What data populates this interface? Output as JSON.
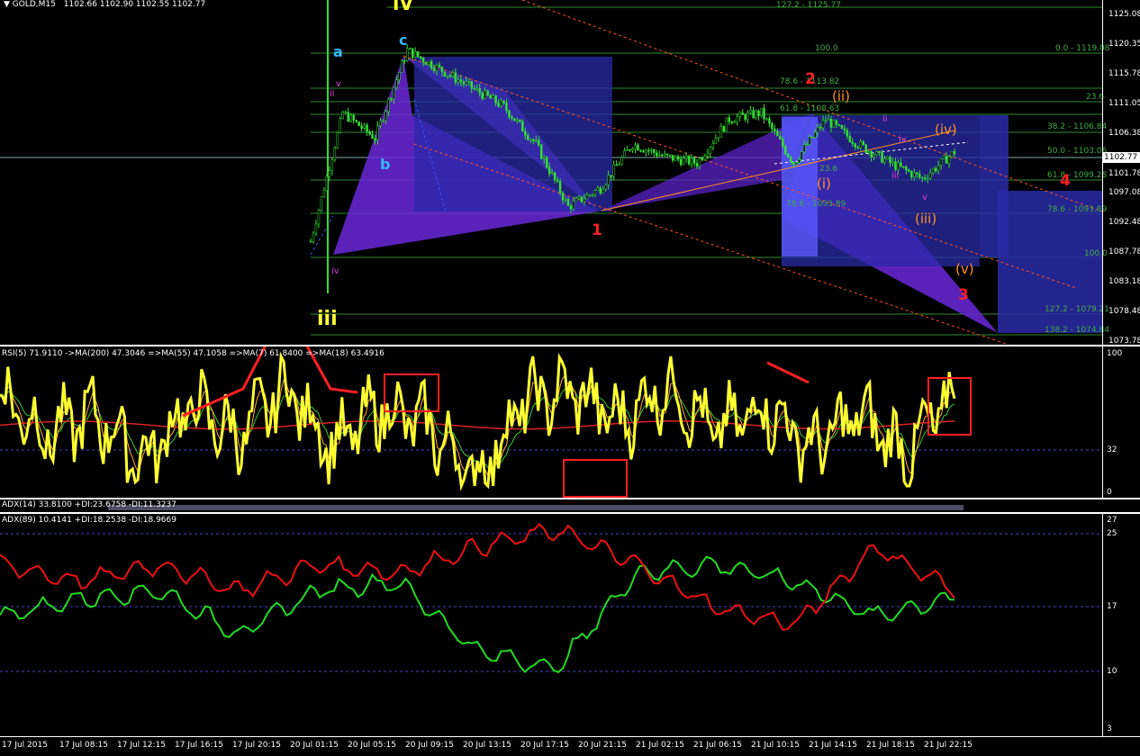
{
  "header": {
    "symbol": "GOLD,M15",
    "ohlc": "1102.66 1102.90 1102.55 1102.77",
    "rsi_legend": "RSI(5) 71.9110  ->MA(200) 47.3046  =>MA(55) 47.1058  =>MA(7) 61.8400  =>MA(18) 63.4916",
    "adx14_legend": "ADX(14) 33.8100 +DI:23.6758 -DI:11.3237",
    "adx89_legend": "ADX(89) 10.4141 +DI:18.2538 -DI:18.9669"
  },
  "colors": {
    "background": "#000000",
    "candle": "#33dd33",
    "fib": "#2e8b2e",
    "rsi": "#ffff33",
    "plus_di": "#22dd22",
    "minus_di": "#ee1111",
    "pattern": "#6a28d8",
    "box": "#2a2aa8",
    "wave_red": "#ff2020",
    "wave_orange": "#ff9020",
    "wave_cyan": "#33bbff",
    "wave_magenta": "#dd44dd",
    "wave_yellow": "#ffff33"
  },
  "price_axis": {
    "ticks": [
      "1125.08",
      "1120.35",
      "1115.78",
      "1111.05",
      "1106.38",
      "1101.78",
      "1097.08",
      "1092.48",
      "1087.78",
      "1083.18",
      "1078.48",
      "1073.78"
    ],
    "current": "1102.77"
  },
  "rsi_axis": {
    "ticks": [
      "100",
      "32",
      "0"
    ]
  },
  "adx_axis": {
    "ticks": [
      "27",
      "25",
      "17",
      "10",
      "3"
    ]
  },
  "time_axis": {
    "ticks": [
      "17 Jul 2015",
      "17 Jul 08:15",
      "17 Jul 12:15",
      "17 Jul 16:15",
      "17 Jul 20:15",
      "20 Jul 01:15",
      "20 Jul 05:15",
      "20 Jul 09:15",
      "20 Jul 13:15",
      "20 Jul 17:15",
      "20 Jul 21:15",
      "21 Jul 02:15",
      "21 Jul 06:15",
      "21 Jul 10:15",
      "21 Jul 14:15",
      "21 Jul 18:15",
      "21 Jul 22:15"
    ]
  },
  "fib_labels": {
    "f1272_top": "127.2 - 1125.77",
    "f100_top": "100.0",
    "f0": "0.0 - 1119.08",
    "f786a": "78.6 - 1113.82",
    "f236": "23.6",
    "f618a": "61.8 - 1108.63",
    "f382": "38.2 - 1106.84",
    "f50": "50.0 - 1103.06",
    "f618b": "61.8 - 1099.28",
    "f786b": "78.6 - 1093.89",
    "f100": "100.0",
    "f1272": "127.2 - 1079.21",
    "f1382": "138.2 - 1074.84",
    "f236b": "23.6",
    "f786c": "78.6 - 1093.89"
  },
  "waves": {
    "IV": "IV",
    "iii_big": "iii",
    "a": "a",
    "c": "c",
    "b": "b",
    "one": "1",
    "two": "2",
    "three": "3",
    "four": "4",
    "w_i": "(i)",
    "w_ii": "(ii)",
    "w_iii": "(iii)",
    "w_iv": "(iv)",
    "w_v": "(v)",
    "sm_ii": "ii",
    "sm_v": "v",
    "sm_iv": "iv",
    "sm_iii": "iii",
    "sm_v2": "v",
    "sm_ii2": "ii",
    "sm_iv2": "iv",
    "sm_iii2": "iii"
  },
  "chart_data": [
    {
      "type": "line",
      "title": "GOLD,M15",
      "series": [
        {
          "name": "GOLD,M15",
          "x": [
            0,
            12,
            24,
            36,
            48,
            60,
            72,
            84,
            96,
            108,
            120,
            132,
            144,
            156,
            168,
            180,
            192,
            204,
            216,
            228,
            240
          ],
          "values": [
            1088.5,
            1109.0,
            1105.0,
            1119.0,
            1116.0,
            1113.0,
            1110.0,
            1104.0,
            1094.0,
            1097.0,
            1104.0,
            1102.0,
            1101.0,
            1108.0,
            1109.0,
            1101.0,
            1108.0,
            1104.0,
            1101.0,
            1098.5,
            1102.77
          ]
        }
      ],
      "ylim": [
        1072.0,
        1127.0
      ]
    },
    {
      "type": "line",
      "title": "RSI(5)",
      "series": [
        {
          "name": "RSI(5)",
          "x": [
            0,
            12,
            24,
            36,
            48,
            60,
            72,
            84,
            96,
            108,
            120,
            132,
            144,
            156,
            168,
            180,
            192,
            204,
            216,
            228,
            240
          ],
          "values": [
            70,
            40,
            55,
            20,
            62,
            38,
            75,
            30,
            60,
            45,
            8,
            65,
            72,
            50,
            78,
            40,
            62,
            30,
            55,
            25,
            71.9
          ]
        },
        {
          "name": "MA(200)",
          "x": [
            0,
            240
          ],
          "values": [
            47,
            47.3
          ]
        }
      ],
      "ylim": [
        0,
        100
      ]
    },
    {
      "type": "line",
      "title": "ADX(89)",
      "series": [
        {
          "name": "+DI",
          "x": [
            0,
            20,
            40,
            60,
            80,
            100,
            120,
            140,
            160,
            180,
            200,
            220,
            240
          ],
          "values": [
            16,
            18,
            19,
            14,
            19,
            20,
            12,
            10,
            21,
            22,
            20,
            16,
            18.25
          ]
        },
        {
          "name": "-DI",
          "x": [
            0,
            20,
            40,
            60,
            80,
            100,
            120,
            140,
            160,
            180,
            200,
            220,
            240
          ],
          "values": [
            22,
            20,
            22,
            19,
            22,
            21,
            24,
            26,
            22,
            17,
            15,
            24,
            18.97
          ]
        }
      ],
      "ylim": [
        3,
        27
      ]
    }
  ]
}
